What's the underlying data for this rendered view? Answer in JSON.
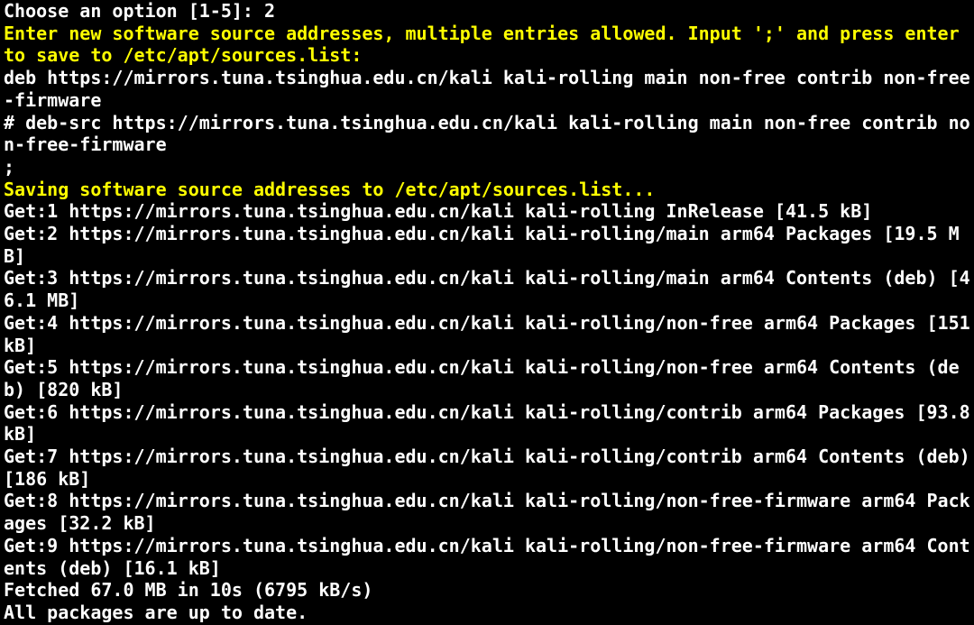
{
  "prompt_line": "Choose an option [1-5]: 2",
  "enter_new_prompt": "Enter new software source addresses, multiple entries allowed. Input ';' and press enter to save to /etc/apt/sources.list:",
  "source_line1": "deb https://mirrors.tuna.tsinghua.edu.cn/kali kali-rolling main non-free contrib non-free-firmware",
  "source_line2": "# deb-src https://mirrors.tuna.tsinghua.edu.cn/kali kali-rolling main non-free contrib non-free-firmware",
  "terminator": ";",
  "saving_msg": "Saving software source addresses to /etc/apt/sources.list...",
  "apt": {
    "get1": "Get:1 https://mirrors.tuna.tsinghua.edu.cn/kali kali-rolling InRelease [41.5 kB]",
    "get2": "Get:2 https://mirrors.tuna.tsinghua.edu.cn/kali kali-rolling/main arm64 Packages [19.5 MB]",
    "get3": "Get:3 https://mirrors.tuna.tsinghua.edu.cn/kali kali-rolling/main arm64 Contents (deb) [46.1 MB]",
    "get4": "Get:4 https://mirrors.tuna.tsinghua.edu.cn/kali kali-rolling/non-free arm64 Packages [151 kB]",
    "get5": "Get:5 https://mirrors.tuna.tsinghua.edu.cn/kali kali-rolling/non-free arm64 Contents (deb) [820 kB]",
    "get6": "Get:6 https://mirrors.tuna.tsinghua.edu.cn/kali kali-rolling/contrib arm64 Packages [93.8 kB]",
    "get7": "Get:7 https://mirrors.tuna.tsinghua.edu.cn/kali kali-rolling/contrib arm64 Contents (deb) [186 kB]",
    "get8": "Get:8 https://mirrors.tuna.tsinghua.edu.cn/kali kali-rolling/non-free-firmware arm64 Packages [32.2 kB]",
    "get9": "Get:9 https://mirrors.tuna.tsinghua.edu.cn/kali kali-rolling/non-free-firmware arm64 Contents (deb) [16.1 kB]",
    "fetched": "Fetched 67.0 MB in 10s (6795 kB/s)",
    "uptodate": "All packages are up to date."
  }
}
